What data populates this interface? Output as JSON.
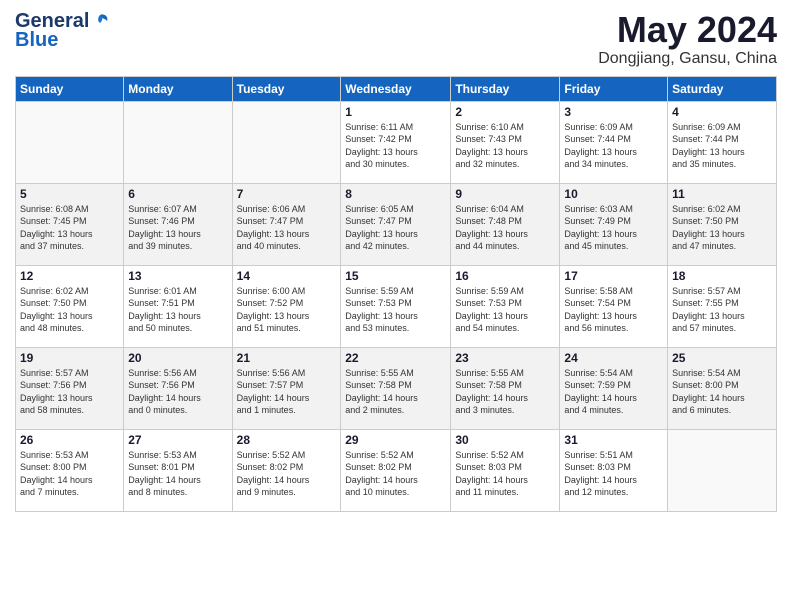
{
  "logo": {
    "line1": "General",
    "line2": "Blue"
  },
  "title": "May 2024",
  "location": "Dongjiang, Gansu, China",
  "weekdays": [
    "Sunday",
    "Monday",
    "Tuesday",
    "Wednesday",
    "Thursday",
    "Friday",
    "Saturday"
  ],
  "weeks": [
    [
      {
        "day": "",
        "info": ""
      },
      {
        "day": "",
        "info": ""
      },
      {
        "day": "",
        "info": ""
      },
      {
        "day": "1",
        "info": "Sunrise: 6:11 AM\nSunset: 7:42 PM\nDaylight: 13 hours\nand 30 minutes."
      },
      {
        "day": "2",
        "info": "Sunrise: 6:10 AM\nSunset: 7:43 PM\nDaylight: 13 hours\nand 32 minutes."
      },
      {
        "day": "3",
        "info": "Sunrise: 6:09 AM\nSunset: 7:44 PM\nDaylight: 13 hours\nand 34 minutes."
      },
      {
        "day": "4",
        "info": "Sunrise: 6:09 AM\nSunset: 7:44 PM\nDaylight: 13 hours\nand 35 minutes."
      }
    ],
    [
      {
        "day": "5",
        "info": "Sunrise: 6:08 AM\nSunset: 7:45 PM\nDaylight: 13 hours\nand 37 minutes."
      },
      {
        "day": "6",
        "info": "Sunrise: 6:07 AM\nSunset: 7:46 PM\nDaylight: 13 hours\nand 39 minutes."
      },
      {
        "day": "7",
        "info": "Sunrise: 6:06 AM\nSunset: 7:47 PM\nDaylight: 13 hours\nand 40 minutes."
      },
      {
        "day": "8",
        "info": "Sunrise: 6:05 AM\nSunset: 7:47 PM\nDaylight: 13 hours\nand 42 minutes."
      },
      {
        "day": "9",
        "info": "Sunrise: 6:04 AM\nSunset: 7:48 PM\nDaylight: 13 hours\nand 44 minutes."
      },
      {
        "day": "10",
        "info": "Sunrise: 6:03 AM\nSunset: 7:49 PM\nDaylight: 13 hours\nand 45 minutes."
      },
      {
        "day": "11",
        "info": "Sunrise: 6:02 AM\nSunset: 7:50 PM\nDaylight: 13 hours\nand 47 minutes."
      }
    ],
    [
      {
        "day": "12",
        "info": "Sunrise: 6:02 AM\nSunset: 7:50 PM\nDaylight: 13 hours\nand 48 minutes."
      },
      {
        "day": "13",
        "info": "Sunrise: 6:01 AM\nSunset: 7:51 PM\nDaylight: 13 hours\nand 50 minutes."
      },
      {
        "day": "14",
        "info": "Sunrise: 6:00 AM\nSunset: 7:52 PM\nDaylight: 13 hours\nand 51 minutes."
      },
      {
        "day": "15",
        "info": "Sunrise: 5:59 AM\nSunset: 7:53 PM\nDaylight: 13 hours\nand 53 minutes."
      },
      {
        "day": "16",
        "info": "Sunrise: 5:59 AM\nSunset: 7:53 PM\nDaylight: 13 hours\nand 54 minutes."
      },
      {
        "day": "17",
        "info": "Sunrise: 5:58 AM\nSunset: 7:54 PM\nDaylight: 13 hours\nand 56 minutes."
      },
      {
        "day": "18",
        "info": "Sunrise: 5:57 AM\nSunset: 7:55 PM\nDaylight: 13 hours\nand 57 minutes."
      }
    ],
    [
      {
        "day": "19",
        "info": "Sunrise: 5:57 AM\nSunset: 7:56 PM\nDaylight: 13 hours\nand 58 minutes."
      },
      {
        "day": "20",
        "info": "Sunrise: 5:56 AM\nSunset: 7:56 PM\nDaylight: 14 hours\nand 0 minutes."
      },
      {
        "day": "21",
        "info": "Sunrise: 5:56 AM\nSunset: 7:57 PM\nDaylight: 14 hours\nand 1 minutes."
      },
      {
        "day": "22",
        "info": "Sunrise: 5:55 AM\nSunset: 7:58 PM\nDaylight: 14 hours\nand 2 minutes."
      },
      {
        "day": "23",
        "info": "Sunrise: 5:55 AM\nSunset: 7:58 PM\nDaylight: 14 hours\nand 3 minutes."
      },
      {
        "day": "24",
        "info": "Sunrise: 5:54 AM\nSunset: 7:59 PM\nDaylight: 14 hours\nand 4 minutes."
      },
      {
        "day": "25",
        "info": "Sunrise: 5:54 AM\nSunset: 8:00 PM\nDaylight: 14 hours\nand 6 minutes."
      }
    ],
    [
      {
        "day": "26",
        "info": "Sunrise: 5:53 AM\nSunset: 8:00 PM\nDaylight: 14 hours\nand 7 minutes."
      },
      {
        "day": "27",
        "info": "Sunrise: 5:53 AM\nSunset: 8:01 PM\nDaylight: 14 hours\nand 8 minutes."
      },
      {
        "day": "28",
        "info": "Sunrise: 5:52 AM\nSunset: 8:02 PM\nDaylight: 14 hours\nand 9 minutes."
      },
      {
        "day": "29",
        "info": "Sunrise: 5:52 AM\nSunset: 8:02 PM\nDaylight: 14 hours\nand 10 minutes."
      },
      {
        "day": "30",
        "info": "Sunrise: 5:52 AM\nSunset: 8:03 PM\nDaylight: 14 hours\nand 11 minutes."
      },
      {
        "day": "31",
        "info": "Sunrise: 5:51 AM\nSunset: 8:03 PM\nDaylight: 14 hours\nand 12 minutes."
      },
      {
        "day": "",
        "info": ""
      }
    ]
  ]
}
